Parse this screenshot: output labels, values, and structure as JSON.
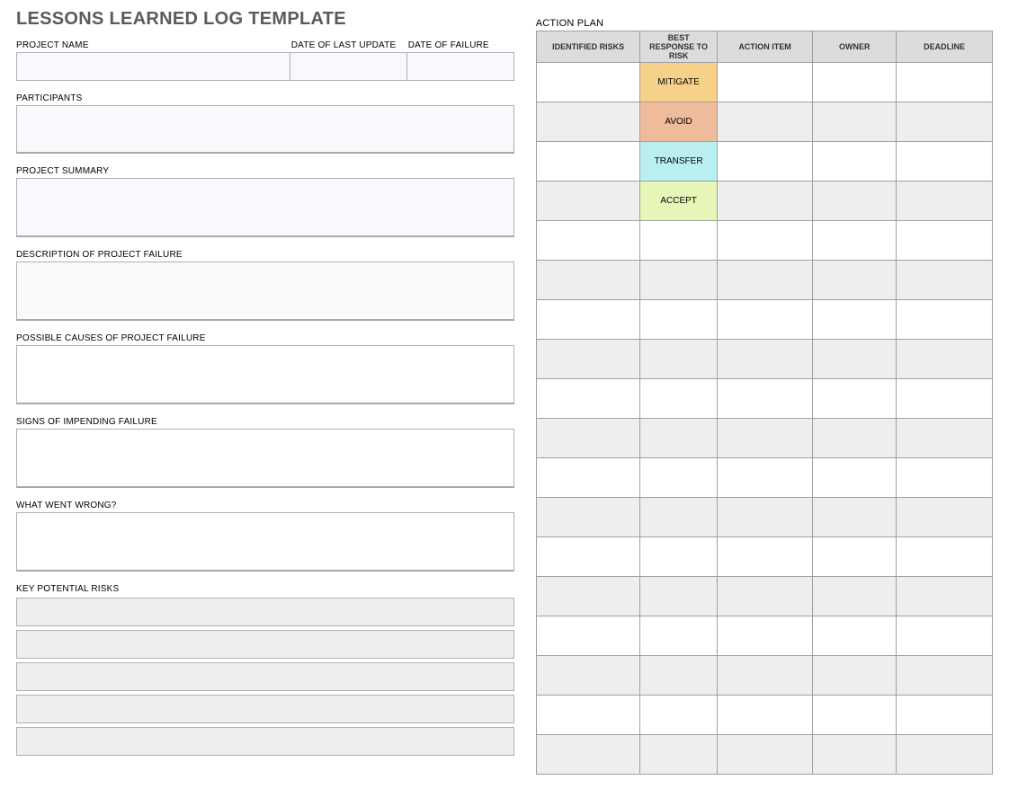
{
  "title": "LESSONS LEARNED LOG TEMPLATE",
  "left": {
    "project_name_label": "PROJECT NAME",
    "date_last_update_label": "DATE OF LAST UPDATE",
    "date_failure_label": "DATE OF FAILURE",
    "project_name_value": "",
    "date_last_update_value": "",
    "date_failure_value": "",
    "participants_label": "PARTICIPANTS",
    "participants_value": "",
    "project_summary_label": "PROJECT SUMMARY",
    "project_summary_value": "",
    "description_failure_label": "DESCRIPTION OF PROJECT FAILURE",
    "description_failure_value": "",
    "possible_causes_label": "POSSIBLE CAUSES OF PROJECT FAILURE",
    "possible_causes_value": "",
    "signs_label": "SIGNS OF IMPENDING FAILURE",
    "signs_value": "",
    "what_wrong_label": "WHAT WENT WRONG?",
    "what_wrong_value": "",
    "key_risks_label": "KEY POTENTIAL RISKS",
    "key_risks": [
      "",
      "",
      "",
      "",
      ""
    ]
  },
  "right": {
    "section_label": "ACTION PLAN",
    "headers": {
      "risks": "IDENTIFIED RISKS",
      "response": "BEST RESPONSE TO RISK",
      "action": "ACTION ITEM",
      "owner": "OWNER",
      "deadline": "DEADLINE"
    },
    "responses": {
      "mitigate": "MITIGATE",
      "avoid": "AVOID",
      "transfer": "TRANSFER",
      "accept": "ACCEPT"
    },
    "rows": [
      {
        "risk": "",
        "response_key": "mitigate",
        "action": "",
        "owner": "",
        "deadline": ""
      },
      {
        "risk": "",
        "response_key": "avoid",
        "action": "",
        "owner": "",
        "deadline": ""
      },
      {
        "risk": "",
        "response_key": "transfer",
        "action": "",
        "owner": "",
        "deadline": ""
      },
      {
        "risk": "",
        "response_key": "accept",
        "action": "",
        "owner": "",
        "deadline": ""
      },
      {
        "risk": "",
        "response_key": "",
        "action": "",
        "owner": "",
        "deadline": ""
      },
      {
        "risk": "",
        "response_key": "",
        "action": "",
        "owner": "",
        "deadline": ""
      },
      {
        "risk": "",
        "response_key": "",
        "action": "",
        "owner": "",
        "deadline": ""
      },
      {
        "risk": "",
        "response_key": "",
        "action": "",
        "owner": "",
        "deadline": ""
      },
      {
        "risk": "",
        "response_key": "",
        "action": "",
        "owner": "",
        "deadline": ""
      },
      {
        "risk": "",
        "response_key": "",
        "action": "",
        "owner": "",
        "deadline": ""
      },
      {
        "risk": "",
        "response_key": "",
        "action": "",
        "owner": "",
        "deadline": ""
      },
      {
        "risk": "",
        "response_key": "",
        "action": "",
        "owner": "",
        "deadline": ""
      },
      {
        "risk": "",
        "response_key": "",
        "action": "",
        "owner": "",
        "deadline": ""
      },
      {
        "risk": "",
        "response_key": "",
        "action": "",
        "owner": "",
        "deadline": ""
      },
      {
        "risk": "",
        "response_key": "",
        "action": "",
        "owner": "",
        "deadline": ""
      },
      {
        "risk": "",
        "response_key": "",
        "action": "",
        "owner": "",
        "deadline": ""
      },
      {
        "risk": "",
        "response_key": "",
        "action": "",
        "owner": "",
        "deadline": ""
      },
      {
        "risk": "",
        "response_key": "",
        "action": "",
        "owner": "",
        "deadline": ""
      }
    ]
  }
}
